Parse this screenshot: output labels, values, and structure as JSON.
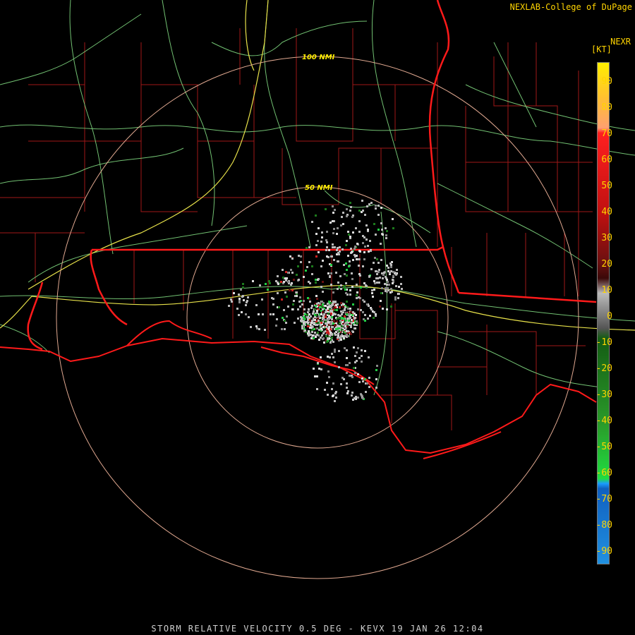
{
  "header": {
    "credit": "NEXLAB-College of DuPage",
    "product": "NEXR",
    "units": "[KT]"
  },
  "rings": [
    "100 NMI",
    "50 NMI"
  ],
  "legend": {
    "ticks": [
      "90",
      "80",
      "70",
      "60",
      "50",
      "40",
      "30",
      "20",
      "10",
      "0",
      "-10",
      "-20",
      "-30",
      "-40",
      "-50",
      "-60",
      "-70",
      "-80",
      "-90"
    ],
    "colors": {
      "outbound_high": "#ffee00",
      "outbound_mid": "#ff2020",
      "outbound_low": "#6a1010",
      "zero": "#bbbbbb",
      "inbound_low": "#145c14",
      "inbound_mid": "#20dd40",
      "inbound_high": "#1a9cff"
    }
  },
  "caption": "STORM RELATIVE VELOCITY 0.5 DEG - KEVX 19 JAN 26 12:04",
  "colors": {
    "state_border": "#ff1a1a",
    "county_line": "#a01818",
    "highway": "#7fd67f",
    "interstate": "#e8e24a",
    "range_ring": "#e0a890"
  }
}
